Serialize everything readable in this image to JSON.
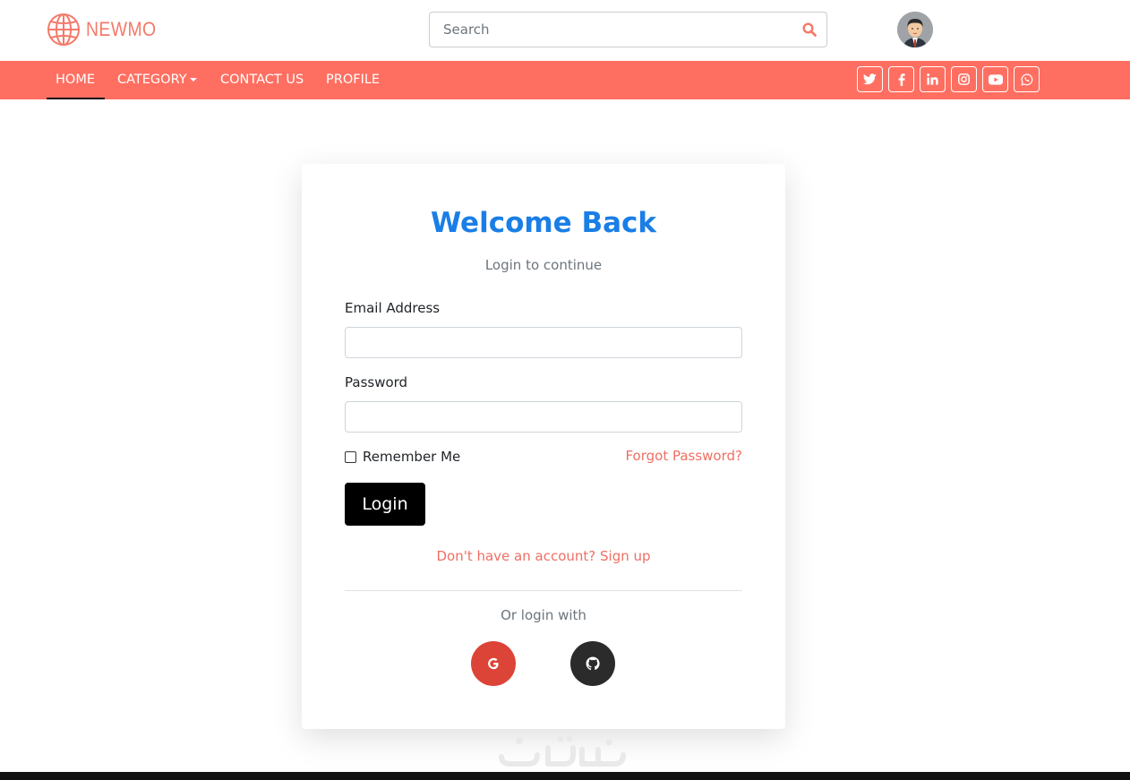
{
  "header": {
    "logo_text": "NEWMO",
    "search": {
      "placeholder": "Search",
      "value": ""
    }
  },
  "nav": {
    "items": [
      {
        "label": "HOME",
        "active": true
      },
      {
        "label": "CATEGORY",
        "has_dropdown": true
      },
      {
        "label": "CONTACT US"
      },
      {
        "label": "PROFILE"
      }
    ],
    "social_icons": [
      "twitter-icon",
      "facebook-icon",
      "linkedin-icon",
      "instagram-icon",
      "youtube-icon",
      "whatsapp-icon"
    ]
  },
  "login_card": {
    "title": "Welcome Back",
    "subtitle": "Login to continue",
    "email_label": "Email Address",
    "email_value": "",
    "password_label": "Password",
    "password_value": "",
    "remember_label": "Remember Me",
    "remember_checked": false,
    "forgot_link": "Forgot Password?",
    "login_button": "Login",
    "signup_link": "Don't have an account? Sign up",
    "or_text": "Or login with",
    "oauth_providers": [
      "google-icon",
      "github-icon"
    ]
  },
  "colors": {
    "brand": "#ff6f61",
    "title": "#1a7ee6",
    "link": "#ee6f63",
    "google": "#db4437",
    "github": "#2b2b2b"
  }
}
